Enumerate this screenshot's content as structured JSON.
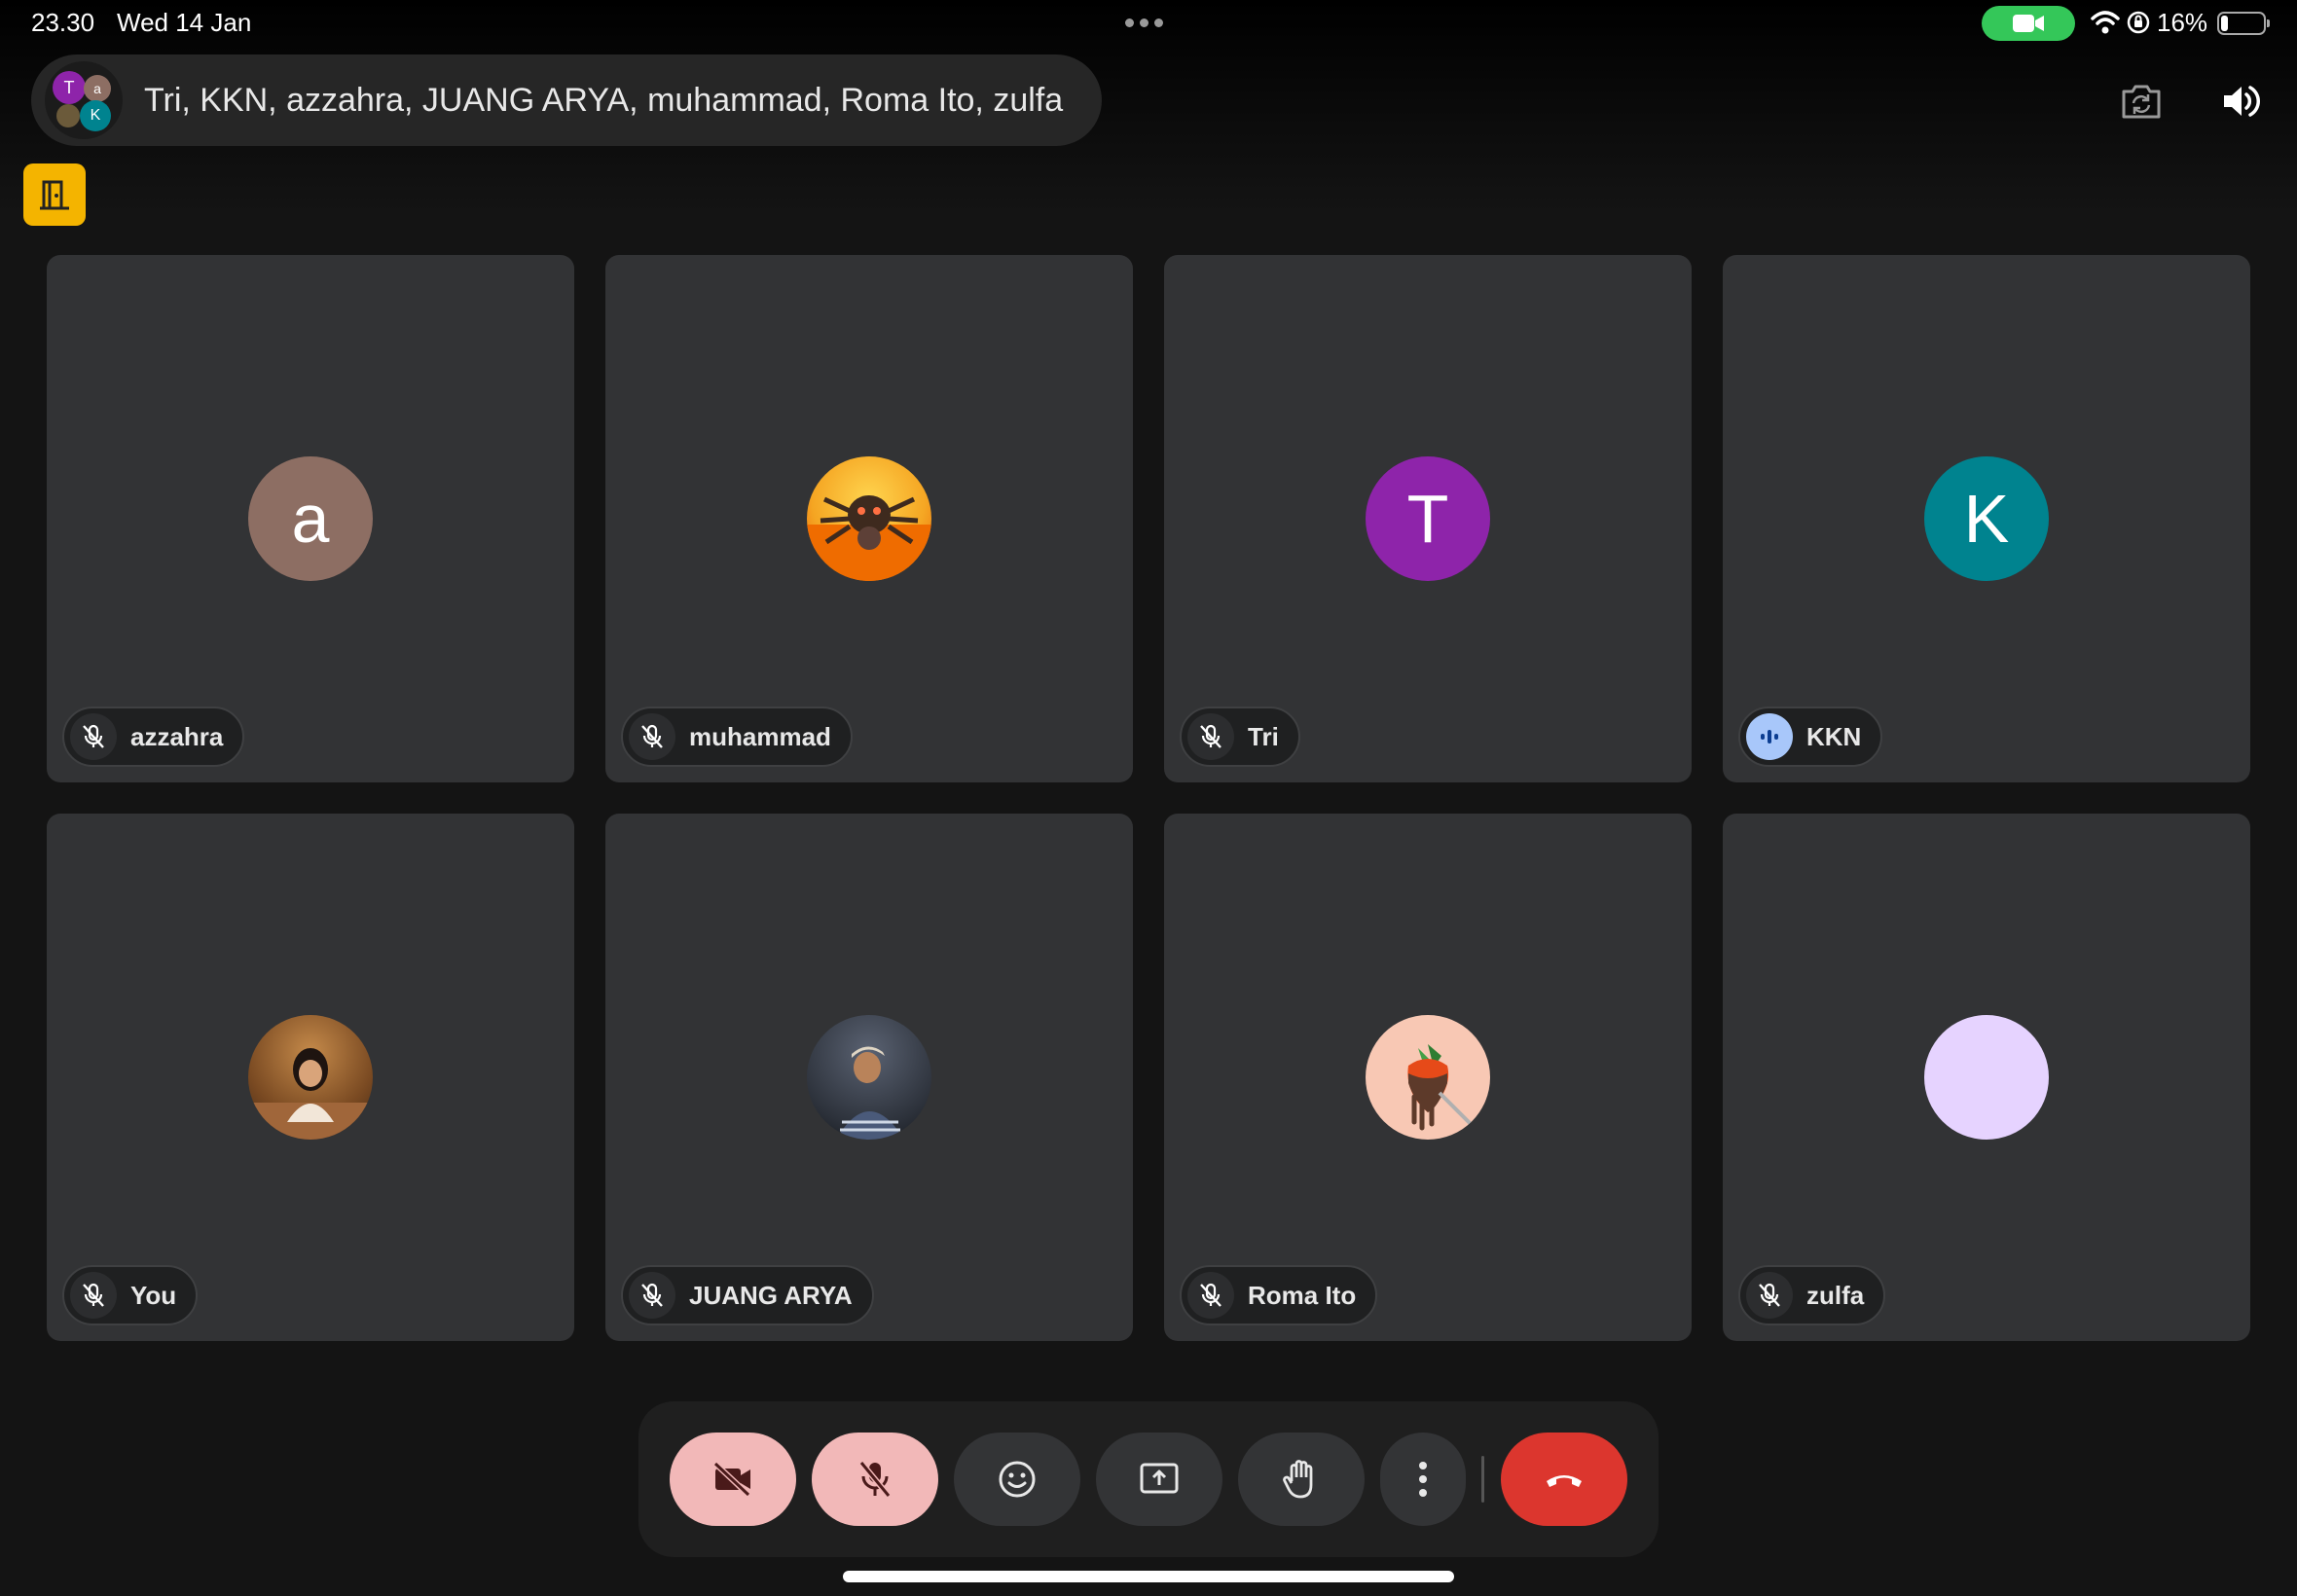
{
  "status_bar": {
    "time": "23.30",
    "date": "Wed 14 Jan",
    "battery": "16%",
    "camera_indicator_color": "#34c759"
  },
  "header": {
    "title": "Tri, KKN, azzahra, JUANG ARYA, muhammad, Roma Ito, zulfa",
    "mini_avatars": [
      {
        "initial": "T",
        "color": "#8e24aa"
      },
      {
        "initial": "a",
        "color": "#8d6e63"
      },
      {
        "initial": "",
        "color": "#6b5a3a"
      },
      {
        "initial": "K",
        "color": "#00838f"
      }
    ],
    "switch_camera_icon": "camera-switch-icon",
    "audio_icon": "speaker-icon"
  },
  "exit_button": {
    "icon": "door-exit-icon",
    "color": "#f4b400"
  },
  "participants": [
    {
      "name": "azzahra",
      "initial": "a",
      "avatar_color": "#8d6e63",
      "mic": "muted"
    },
    {
      "name": "muhammad",
      "initial": "",
      "avatar_color": "#f5a623",
      "mic": "muted"
    },
    {
      "name": "Tri",
      "initial": "T",
      "avatar_color": "#8e24aa",
      "mic": "muted"
    },
    {
      "name": "KKN",
      "initial": "K",
      "avatar_color": "#00838f",
      "mic": "speaking"
    },
    {
      "name": "You",
      "initial": "",
      "avatar_color": "#6b4a2e",
      "mic": "muted"
    },
    {
      "name": "JUANG ARYA",
      "initial": "",
      "avatar_color": "#3a4250",
      "mic": "muted"
    },
    {
      "name": "Roma Ito",
      "initial": "",
      "avatar_color": "#f8c8b4",
      "mic": "muted"
    },
    {
      "name": "zulfa",
      "initial": "",
      "avatar_color": "#e6d3ff",
      "mic": "muted"
    }
  ],
  "controls": [
    {
      "id": "camera",
      "icon": "camera-off-icon",
      "state": "off"
    },
    {
      "id": "mic",
      "icon": "mic-off-icon",
      "state": "off"
    },
    {
      "id": "reactions",
      "icon": "emoji-icon"
    },
    {
      "id": "present",
      "icon": "present-screen-icon"
    },
    {
      "id": "raise-hand",
      "icon": "raise-hand-icon"
    },
    {
      "id": "more",
      "icon": "more-vert-icon"
    },
    {
      "id": "leave",
      "icon": "end-call-icon",
      "color": "#dc362e"
    }
  ]
}
